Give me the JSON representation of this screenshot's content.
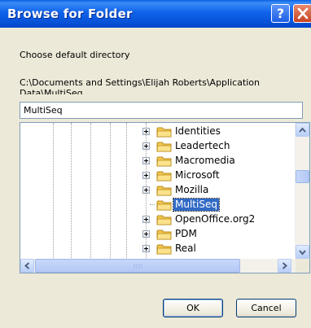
{
  "window": {
    "title": "Browse for Folder"
  },
  "titlebar": {
    "help_icon": "help-icon",
    "close_icon": "close-icon"
  },
  "dialog": {
    "instruction": "Choose default directory",
    "path": "C:\\Documents and Settings\\Elijah Roberts\\Application Data\\MultiSeq",
    "folder_value": "MultiSeq"
  },
  "tree": {
    "items": [
      {
        "label": "Identities",
        "expander": true,
        "selected": false
      },
      {
        "label": "Leadertech",
        "expander": true,
        "selected": false
      },
      {
        "label": "Macromedia",
        "expander": true,
        "selected": false
      },
      {
        "label": "Microsoft",
        "expander": true,
        "selected": false
      },
      {
        "label": "Mozilla",
        "expander": true,
        "selected": false
      },
      {
        "label": "MultiSeq",
        "expander": false,
        "selected": true
      },
      {
        "label": "OpenOffice.org2",
        "expander": true,
        "selected": false
      },
      {
        "label": "PDM",
        "expander": true,
        "selected": false
      },
      {
        "label": "Real",
        "expander": true,
        "selected": false
      }
    ]
  },
  "buttons": {
    "ok": "OK",
    "cancel": "Cancel"
  },
  "colors": {
    "titlebar": "#0a5fe0",
    "selection": "#316ac5",
    "face": "#ece9d8"
  }
}
